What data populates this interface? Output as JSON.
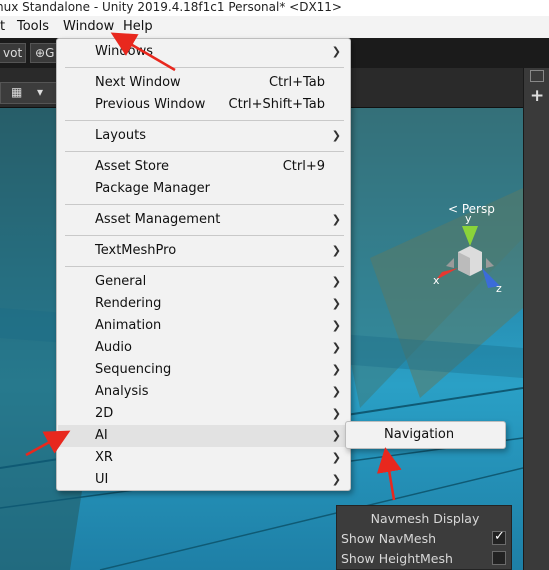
{
  "title": "nux Standalone - Unity 2019.4.18f1c1 Personal* <DX11>",
  "menubar": {
    "items": [
      "t",
      "Tools",
      "Window",
      "Help"
    ]
  },
  "toolbar": {
    "pivot_label": "vot",
    "global_label": "G"
  },
  "gizmo": {
    "y": "y",
    "x": "x",
    "z": "z",
    "persp": "< Persp"
  },
  "window_menu": {
    "items": [
      {
        "label": "Windows",
        "shortcut": "",
        "submenu": true
      },
      {
        "label": "Next Window",
        "shortcut": "Ctrl+Tab",
        "submenu": false
      },
      {
        "label": "Previous Window",
        "shortcut": "Ctrl+Shift+Tab",
        "submenu": false
      },
      {
        "label": "Layouts",
        "shortcut": "",
        "submenu": true
      },
      {
        "label": "Asset Store",
        "shortcut": "Ctrl+9",
        "submenu": false
      },
      {
        "label": "Package Manager",
        "shortcut": "",
        "submenu": false
      },
      {
        "label": "Asset Management",
        "shortcut": "",
        "submenu": true
      },
      {
        "label": "TextMeshPro",
        "shortcut": "",
        "submenu": true
      },
      {
        "label": "General",
        "shortcut": "",
        "submenu": true
      },
      {
        "label": "Rendering",
        "shortcut": "",
        "submenu": true
      },
      {
        "label": "Animation",
        "shortcut": "",
        "submenu": true
      },
      {
        "label": "Audio",
        "shortcut": "",
        "submenu": true
      },
      {
        "label": "Sequencing",
        "shortcut": "",
        "submenu": true
      },
      {
        "label": "Analysis",
        "shortcut": "",
        "submenu": true
      },
      {
        "label": "2D",
        "shortcut": "",
        "submenu": true
      },
      {
        "label": "AI",
        "shortcut": "",
        "submenu": true,
        "highlighted": true
      },
      {
        "label": "XR",
        "shortcut": "",
        "submenu": true
      },
      {
        "label": "UI",
        "shortcut": "",
        "submenu": true
      }
    ]
  },
  "ai_submenu": {
    "items": [
      "Navigation"
    ]
  },
  "navmesh_display": {
    "title": "Navmesh Display",
    "rows": [
      {
        "label": "Show NavMesh",
        "checked": true
      },
      {
        "label": "Show HeightMesh",
        "checked": false
      }
    ]
  },
  "colors": {
    "annotation_arrow": "#e8281e",
    "menu_bg": "#f2f2f2",
    "highlight": "#e2e2e2"
  }
}
